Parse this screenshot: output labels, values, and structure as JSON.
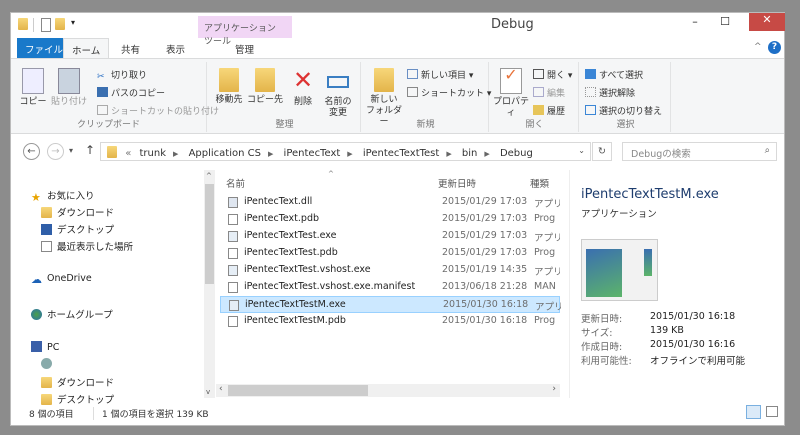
{
  "window": {
    "title": "Debug",
    "minimize": "–",
    "maximize": "☐",
    "close": "✕"
  },
  "ribbon_tabs": {
    "file": "ファイル",
    "home": "ホーム",
    "share": "共有",
    "view": "表示",
    "context_group": "アプリケーション ツール",
    "manage": "管理"
  },
  "ribbon": {
    "clipboard": {
      "label": "クリップボード",
      "copy": "コピー",
      "paste": "貼り付け",
      "cut": "切り取り",
      "copy_path": "パスのコピー",
      "paste_shortcut": "ショートカットの貼り付け"
    },
    "organize": {
      "label": "整理",
      "move_to": "移動先",
      "copy_to": "コピー先",
      "delete": "削除",
      "rename_1": "名前の",
      "rename_2": "変更"
    },
    "new": {
      "label": "新規",
      "new_folder_1": "新しい",
      "new_folder_2": "フォルダー",
      "new_item": "新しい項目 ▾",
      "shortcut": "ショートカット ▾"
    },
    "open": {
      "label": "開く",
      "properties": "プロパティ",
      "open": "開く ▾",
      "edit": "編集",
      "history": "履歴"
    },
    "select": {
      "label": "選択",
      "select_all": "すべて選択",
      "select_none": "選択解除",
      "invert": "選択の切り替え"
    }
  },
  "address": {
    "prefix": "«",
    "crumbs": [
      "trunk",
      "Application CS",
      "iPentecText",
      "iPentecTextTest",
      "bin",
      "Debug"
    ],
    "search_placeholder": "Debugの検索"
  },
  "nav": {
    "favorites": "お気に入り",
    "downloads": "ダウンロード",
    "desktop": "デスクトップ",
    "recent": "最近表示した場所",
    "onedrive": "OneDrive",
    "homegroup": "ホームグループ",
    "pc": "PC",
    "pc_downloads": "ダウンロード",
    "pc_desktop": "デスクトップ"
  },
  "columns": {
    "name": "名前",
    "date": "更新日時",
    "type": "種類"
  },
  "files": [
    {
      "name": "iPentecText.dll",
      "date": "2015/01/29 17:03",
      "type": "アプリ"
    },
    {
      "name": "iPentecText.pdb",
      "date": "2015/01/29 17:03",
      "type": "Prog"
    },
    {
      "name": "iPentecTextTest.exe",
      "date": "2015/01/29 17:03",
      "type": "アプリ"
    },
    {
      "name": "iPentecTextTest.pdb",
      "date": "2015/01/29 17:03",
      "type": "Prog"
    },
    {
      "name": "iPentecTextTest.vshost.exe",
      "date": "2015/01/19 14:35",
      "type": "アプリ"
    },
    {
      "name": "iPentecTextTest.vshost.exe.manifest",
      "date": "2013/06/18 21:28",
      "type": "MAN"
    },
    {
      "name": "iPentecTextTestM.exe",
      "date": "2015/01/30 16:18",
      "type": "アプリ"
    },
    {
      "name": "iPentecTextTestM.pdb",
      "date": "2015/01/30 16:18",
      "type": "Prog"
    }
  ],
  "details": {
    "title": "iPentecTextTestM.exe",
    "kind": "アプリケーション",
    "modified_label": "更新日時:",
    "modified": "2015/01/30 16:18",
    "size_label": "サイズ:",
    "size": "139 KB",
    "created_label": "作成日時:",
    "created": "2015/01/30 16:16",
    "avail_label": "利用可能性:",
    "avail": "オフラインで利用可能"
  },
  "status": {
    "count": "8 個の項目",
    "selected": "1 個の項目を選択  139 KB"
  }
}
